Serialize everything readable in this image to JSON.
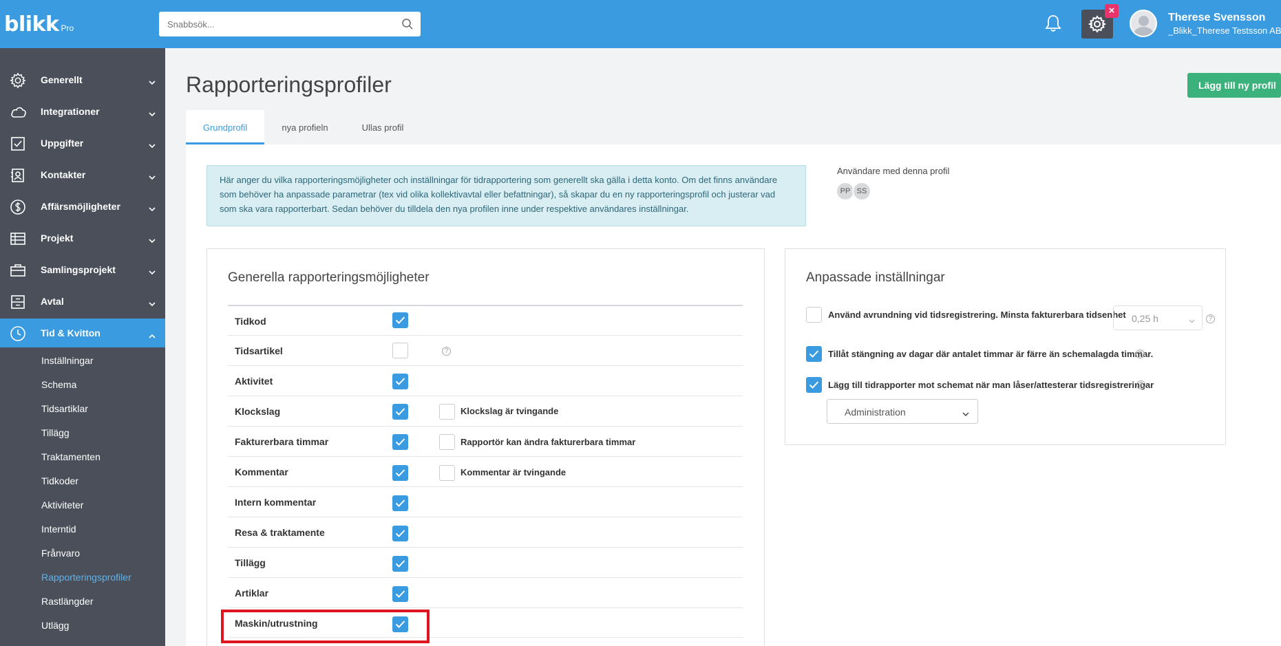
{
  "app": {
    "logo": "blikk",
    "logo_suffix": "Pro",
    "search_placeholder": "Snabbsök...",
    "badge": "×",
    "user_name": "Therese Svensson",
    "user_org": "_Blikk_Therese Testsson AB"
  },
  "sidebar": {
    "items": [
      {
        "label": "Generellt",
        "icon": "gear-icon"
      },
      {
        "label": "Integrationer",
        "icon": "cloud-icon"
      },
      {
        "label": "Uppgifter",
        "icon": "checkbox-icon"
      },
      {
        "label": "Kontakter",
        "icon": "contact-card-icon"
      },
      {
        "label": "Affärsmöjligheter",
        "icon": "dollar-icon"
      },
      {
        "label": "Projekt",
        "icon": "table-icon"
      },
      {
        "label": "Samlingsprojekt",
        "icon": "briefcase-icon"
      },
      {
        "label": "Avtal",
        "icon": "cabinet-icon"
      },
      {
        "label": "Tid & Kvitton",
        "icon": "clock-icon"
      }
    ],
    "sub_items": [
      "Inställningar",
      "Schema",
      "Tidsartiklar",
      "Tillägg",
      "Traktamenten",
      "Tidkoder",
      "Aktiviteter",
      "Interntid",
      "Frånvaro",
      "Rapporteringsprofiler",
      "Rastlängder",
      "Utlägg"
    ],
    "current_sub": "Rapporteringsprofiler"
  },
  "main": {
    "title": "Rapporteringsprofiler",
    "add_button": "Lägg till ny profil",
    "tabs": [
      "Grundprofil",
      "nya profieln",
      "Ullas profil"
    ],
    "info_text": "Här anger du vilka rapporteringsmöjligheter och inställningar för tidrapportering som generellt ska gälla i detta konto. Om det finns användare som behöver ha anpassade parametrar (tex vid olika kollektivavtal eller befattningar), så skapar du en ny rapporteringsprofil och justerar vad som ska vara rapporterbart. Sedan behöver du tilldela den nya profilen inne under respektive användares inställningar.",
    "users_title": "Användare med denna profil",
    "users": [
      "PP",
      "SS"
    ]
  },
  "general": {
    "title": "Generella rapporteringsmöjligheter",
    "help_glyph": "?",
    "rows": [
      {
        "label": "Tidkod",
        "checked": true,
        "sub": null
      },
      {
        "label": "Tidsartikel",
        "checked": false,
        "sub": null
      },
      {
        "label": "Aktivitet",
        "checked": true,
        "sub": null
      },
      {
        "label": "Klockslag",
        "checked": true,
        "sub": "Klockslag är tvingande"
      },
      {
        "label": "Fakturerbara timmar",
        "checked": true,
        "sub": "Rapportör kan ändra fakturerbara timmar"
      },
      {
        "label": "Kommentar",
        "checked": true,
        "sub": "Kommentar är tvingande"
      },
      {
        "label": "Intern kommentar",
        "checked": true,
        "sub": null
      },
      {
        "label": "Resa & traktamente",
        "checked": true,
        "sub": null
      },
      {
        "label": "Tillägg",
        "checked": true,
        "sub": null
      },
      {
        "label": "Artiklar",
        "checked": true,
        "sub": null
      },
      {
        "label": "Maskin/utrustning",
        "checked": true,
        "sub": null
      }
    ]
  },
  "custom": {
    "title": "Anpassade inställningar",
    "rounding_label": "Använd avrundning vid tidsregistrering. Minsta fakturerbara tidsenhet",
    "rounding_checked": false,
    "rounding_value": "0,25 h",
    "close_days_label": "Tillåt stängning av dagar där antalet timmar är färre än schemalagda timmar.",
    "close_days_checked": true,
    "add_reports_label": "Lägg till tidrapporter mot schemat när man låser/attesterar tidsregistreringar",
    "add_reports_checked": true,
    "activity_select": "Administration"
  },
  "colors": {
    "primary": "#3a9be0",
    "sidebar": "#4a4f59",
    "success": "#3bb27c",
    "badge": "#e8336b",
    "highlight": "#e0141e"
  }
}
